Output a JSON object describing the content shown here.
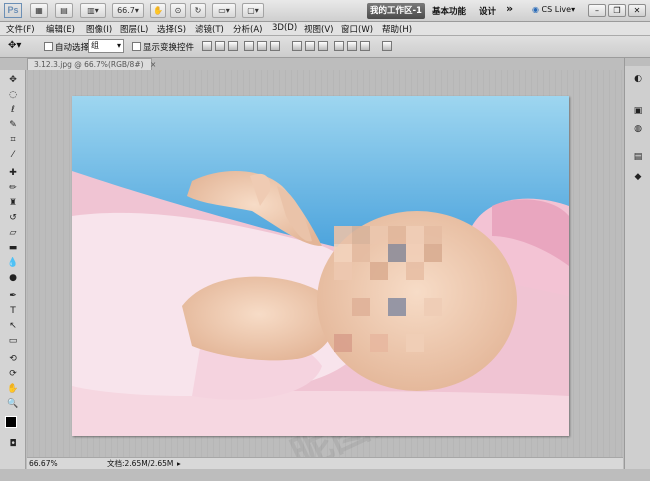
{
  "app": {
    "logo": "Ps"
  },
  "titlebar": {
    "zoom_value": "66.7",
    "workspace_active": "我的工作区-1",
    "workspace_basic": "基本功能",
    "workspace_design": "设计",
    "more": "»",
    "cs_live": "CS Live",
    "icons": [
      "bridge-icon",
      "minibridge-icon",
      "view-extras-icon",
      "zoom-icon",
      "hand-icon",
      "rotate-icon",
      "arrange-icon",
      "screen-mode-icon"
    ]
  },
  "menubar": {
    "items": [
      "文件(F)",
      "编辑(E)",
      "图像(I)",
      "图层(L)",
      "选择(S)",
      "滤镜(T)",
      "分析(A)",
      "3D(D)",
      "视图(V)",
      "窗口(W)",
      "帮助(H)"
    ]
  },
  "options": {
    "auto_select_label": "自动选择:",
    "auto_select_value": "组",
    "show_transform_label": "显示变换控件"
  },
  "document": {
    "tab_label": "3.12.3.jpg @ 66.7%(RGB/8#)",
    "tab_close": "×"
  },
  "statusbar": {
    "zoom": "66.67%",
    "doc_info": "文档:2.65M/2.65M"
  },
  "colors": {
    "sky_top": "#8fd0ee",
    "sky_bottom": "#2b8fd6",
    "blanket": "#f1c9d6",
    "skin": "#f2cfb7",
    "workspace_active_bg": "#5a5a5a"
  }
}
